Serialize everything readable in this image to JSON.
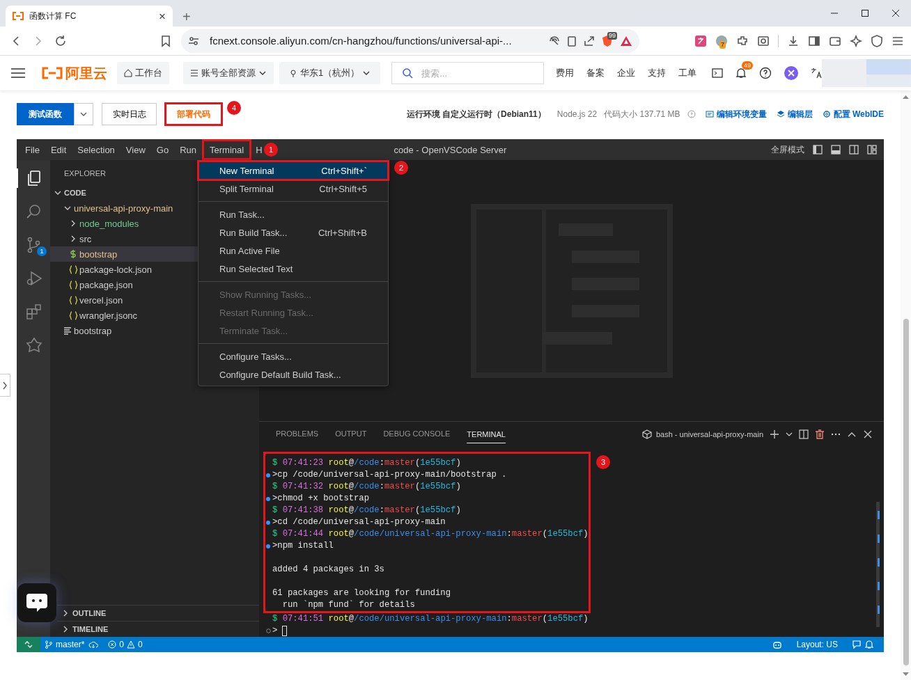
{
  "browser": {
    "tab": {
      "title": "函数计算 FC",
      "close": "×",
      "selected": true
    },
    "new_tab": "+",
    "address": {
      "url": "fcnext.console.aliyun.com/cn-hangzhou/functions/universal-api-..."
    },
    "shield_badge": "99",
    "profile_badge": "7"
  },
  "console_header": {
    "logo": "阿里云",
    "workbench": "工作台",
    "resources": "账号全部资源",
    "region": "华东1（杭州）",
    "search": {
      "placeholder": "搜索..."
    },
    "links": [
      "费用",
      "备案",
      "企业",
      "支持",
      "工单"
    ],
    "notification_badge": "49"
  },
  "toolbar": {
    "test_button": "测试函数",
    "log_button": "实时日志",
    "deploy_button": {
      "label": "部署代码",
      "callout": "4"
    },
    "runtime": "运行环境 自定义运行时（Debian11）",
    "node": "Node.js 22",
    "code_size": "代码大小 137.71 MB",
    "links": [
      {
        "kind": "env",
        "label": "编辑环境变量"
      },
      {
        "kind": "layer",
        "label": "编辑层"
      },
      {
        "kind": "config",
        "label": "配置 WebIDE"
      }
    ]
  },
  "ide": {
    "menu_bar": [
      {
        "label": "File"
      },
      {
        "label": "Edit"
      },
      {
        "label": "Selection"
      },
      {
        "label": "View"
      },
      {
        "label": "Go"
      },
      {
        "label": "Run"
      },
      {
        "label": "Terminal",
        "callout": "1"
      },
      {
        "label": "H"
      }
    ],
    "title": "code - OpenVSCode Server",
    "fullscreen": "全屏模式",
    "activity_bar": [
      {
        "kind": "explorer",
        "selected": true
      },
      {
        "kind": "search",
        "selected": false
      },
      {
        "kind": "source-control",
        "selected": false,
        "badge": "1"
      },
      {
        "kind": "run-debug",
        "selected": false
      },
      {
        "kind": "extensions",
        "selected": false
      },
      {
        "kind": "remote",
        "selected": false
      }
    ],
    "explorer": {
      "title": "EXPLORER",
      "section": {
        "label": "CODE",
        "expanded": true,
        "children": [
          {
            "label": "universal-api-proxy-main",
            "kind": "folder",
            "expanded": true,
            "color": "#e2c08d",
            "selected": false,
            "children": [
              {
                "label": "node_modules",
                "kind": "folder",
                "expanded": false,
                "color": "#73c991",
                "selected": false
              },
              {
                "label": "src",
                "kind": "folder",
                "expanded": false,
                "color": "#cccccc",
                "selected": false
              },
              {
                "label": "bootstrap",
                "kind": "shell",
                "color": "#e2c08d",
                "selected": true
              },
              {
                "label": "package-lock.json",
                "kind": "json",
                "color": "#cccccc",
                "selected": false
              },
              {
                "label": "package.json",
                "kind": "json",
                "color": "#cccccc",
                "selected": false
              },
              {
                "label": "vercel.json",
                "kind": "json",
                "color": "#cccccc",
                "selected": false
              },
              {
                "label": "wrangler.jsonc",
                "kind": "json",
                "color": "#cccccc",
                "selected": false
              }
            ]
          },
          {
            "label": "bootstrap",
            "kind": "text",
            "color": "#cccccc",
            "selected": false
          }
        ]
      }
    },
    "bottom_sections": [
      {
        "label": "OUTLINE",
        "expanded": false
      },
      {
        "label": "TIMELINE",
        "expanded": false
      }
    ],
    "terminal_menu": {
      "groups": [
        [
          {
            "label": "New Terminal",
            "shortcut": "Ctrl+Shift+`",
            "selected": true,
            "disabled": false,
            "callout": "2"
          },
          {
            "label": "Split Terminal",
            "shortcut": "Ctrl+Shift+5",
            "selected": false,
            "disabled": false
          }
        ],
        [
          {
            "label": "Run Task...",
            "selected": false,
            "disabled": false
          },
          {
            "label": "Run Build Task...",
            "shortcut": "Ctrl+Shift+B",
            "selected": false,
            "disabled": false
          },
          {
            "label": "Run Active File",
            "selected": false,
            "disabled": false
          },
          {
            "label": "Run Selected Text",
            "selected": false,
            "disabled": false
          }
        ],
        [
          {
            "label": "Show Running Tasks...",
            "selected": false,
            "disabled": true
          },
          {
            "label": "Restart Running Task...",
            "selected": false,
            "disabled": true
          },
          {
            "label": "Terminate Task...",
            "selected": false,
            "disabled": true
          }
        ],
        [
          {
            "label": "Configure Tasks...",
            "selected": false,
            "disabled": false
          },
          {
            "label": "Configure Default Build Task...",
            "selected": false,
            "disabled": false
          }
        ]
      ]
    },
    "panel": {
      "tabs": [
        {
          "label": "PROBLEMS",
          "selected": false
        },
        {
          "label": "OUTPUT",
          "selected": false
        },
        {
          "label": "DEBUG CONSOLE",
          "selected": false
        },
        {
          "label": "TERMINAL",
          "selected": true
        }
      ],
      "terminal_name": "bash - universal-api-proxy-main",
      "terminal": {
        "callout": "3",
        "boxed": [
          {
            "kind": "prompt",
            "segments": [
              {
                "text": "$",
                "color": "#23d18b"
              },
              {
                "text": "07:41:23",
                "color": "#d670d6"
              },
              {
                "text": "root",
                "color": "#f5f543"
              },
              {
                "text": "@"
              },
              {
                "text": "/code",
                "color": "#3b8eea"
              },
              {
                "text": ":"
              },
              {
                "text": "master",
                "color": "#f14c4c"
              },
              {
                "text": "("
              },
              {
                "text": "1e55bcf",
                "color": "#29b8db"
              },
              {
                "text": ")"
              }
            ]
          },
          {
            "kind": "command",
            "text": ">cp /code/universal-api-proxy-main/bootstrap ."
          },
          {
            "kind": "prompt",
            "segments": [
              {
                "text": "$",
                "color": "#23d18b"
              },
              {
                "text": "07:41:32",
                "color": "#d670d6"
              },
              {
                "text": "root",
                "color": "#f5f543"
              },
              {
                "text": "@"
              },
              {
                "text": "/code",
                "color": "#3b8eea"
              },
              {
                "text": ":"
              },
              {
                "text": "master",
                "color": "#f14c4c"
              },
              {
                "text": "("
              },
              {
                "text": "1e55bcf",
                "color": "#29b8db"
              },
              {
                "text": ")"
              }
            ]
          },
          {
            "kind": "command",
            "text": ">chmod +x bootstrap"
          },
          {
            "kind": "prompt",
            "segments": [
              {
                "text": "$",
                "color": "#23d18b"
              },
              {
                "text": "07:41:38",
                "color": "#d670d6"
              },
              {
                "text": "root",
                "color": "#f5f543"
              },
              {
                "text": "@"
              },
              {
                "text": "/code",
                "color": "#3b8eea"
              },
              {
                "text": ":"
              },
              {
                "text": "master",
                "color": "#f14c4c"
              },
              {
                "text": "("
              },
              {
                "text": "1e55bcf",
                "color": "#29b8db"
              },
              {
                "text": ")"
              }
            ]
          },
          {
            "kind": "command",
            "text": ">cd /code/universal-api-proxy-main"
          },
          {
            "kind": "prompt",
            "segments": [
              {
                "text": "$",
                "color": "#23d18b"
              },
              {
                "text": "07:41:44",
                "color": "#d670d6"
              },
              {
                "text": "root",
                "color": "#f5f543"
              },
              {
                "text": "@"
              },
              {
                "text": "/code/universal-api-proxy-main",
                "color": "#3b8eea"
              },
              {
                "text": ":"
              },
              {
                "text": "master",
                "color": "#f14c4c"
              },
              {
                "text": "("
              },
              {
                "text": "1e55bcf",
                "color": "#29b8db"
              },
              {
                "text": ")"
              }
            ]
          },
          {
            "kind": "command",
            "text": ">npm install"
          },
          {
            "kind": "blank"
          },
          {
            "kind": "output",
            "text": "added 4 packages in 3s"
          },
          {
            "kind": "blank"
          },
          {
            "kind": "output",
            "text": "61 packages are looking for funding"
          },
          {
            "kind": "output",
            "text": "  run `npm fund` for details"
          }
        ],
        "rest": [
          {
            "kind": "prompt",
            "segments": [
              {
                "text": "$",
                "color": "#23d18b"
              },
              {
                "text": "07:41:51",
                "color": "#d670d6"
              },
              {
                "text": "root",
                "color": "#f5f543"
              },
              {
                "text": "@"
              },
              {
                "text": "/code/universal-api-proxy-main",
                "color": "#3b8eea"
              },
              {
                "text": ":"
              },
              {
                "text": "master",
                "color": "#f14c4c"
              },
              {
                "text": "("
              },
              {
                "text": "1e55bcf",
                "color": "#29b8db"
              },
              {
                "text": ")"
              }
            ]
          },
          {
            "kind": "input",
            "text": ">"
          }
        ]
      }
    },
    "status_bar": {
      "branch": "master*",
      "errors": "0",
      "warnings": "0",
      "layout": "Layout: US"
    }
  }
}
